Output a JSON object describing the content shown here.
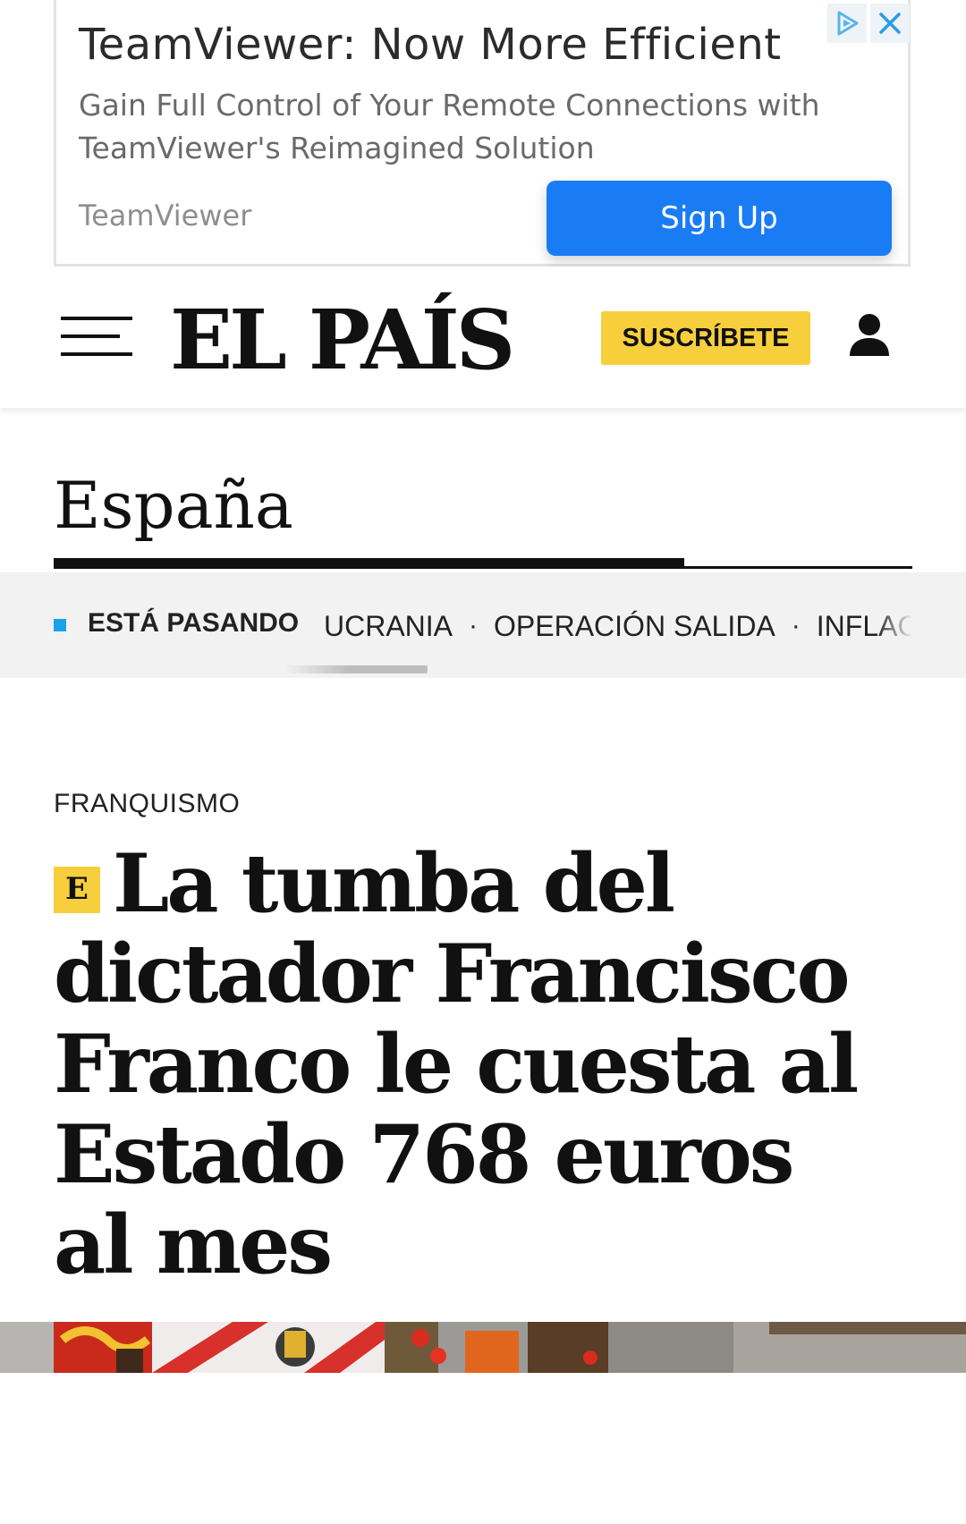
{
  "ad": {
    "title": "TeamViewer: Now More Efficient",
    "description": "Gain Full Control of Your Remote Connections with TeamViewer's Reimagined Solution",
    "brand": "TeamViewer",
    "cta_label": "Sign Up",
    "choices_icon": "adchoices-play-icon",
    "close_icon": "close-icon",
    "cta_color": "#1a7cf5"
  },
  "header": {
    "logo_text": "EL PAÍS",
    "subscribe_label": "SUSCRÍBETE",
    "subscribe_color": "#f7cf3d",
    "menu_icon": "hamburger-menu-icon",
    "user_icon": "user-account-icon"
  },
  "section": {
    "title": "España"
  },
  "trending": {
    "label": "ESTÁ PASANDO",
    "dot_color": "#1aa3e8",
    "items": [
      "UCRANIA",
      "OPERACIÓN SALIDA",
      "INFLACIÓN"
    ],
    "separator": "·"
  },
  "article": {
    "kicker": "FRANQUISMO",
    "badge": "E",
    "headline": "La tumba del dictador Francisco Franco le cuesta al Estado 768 euros al mes"
  }
}
